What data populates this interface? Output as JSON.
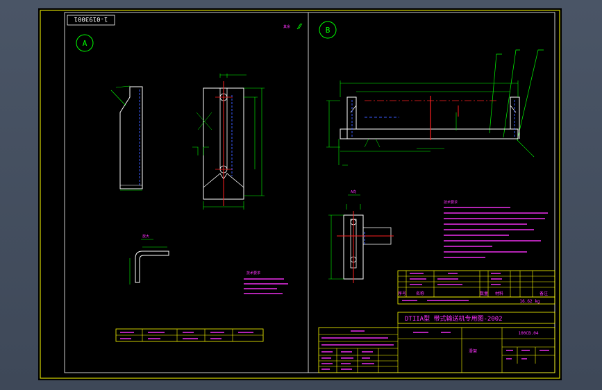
{
  "drawing": {
    "code": "1-0193001",
    "view_a": "A",
    "view_b": "B",
    "corner_note": "其余"
  },
  "colors": {
    "background": "#000000",
    "frame": "#ffff00",
    "geometry": "#00ff00",
    "annotation": "#ff33ff",
    "centerline": "#ff2020",
    "hidden": "#3a5cff"
  },
  "title_block": {
    "product": "DTIIA型 带式输送机专用图-2002",
    "scale_label": "比例",
    "mass": "16.62 kg",
    "part_no": "100CB.04",
    "part_name": "滑架",
    "header_cells": [
      "序号",
      "名称",
      "数量",
      "材料",
      "备注"
    ]
  },
  "glyph_annotations": {
    "tech_notes_b": "技术要求",
    "tech_notes_a": "技术要求",
    "section": "A向",
    "detail": "放大"
  }
}
